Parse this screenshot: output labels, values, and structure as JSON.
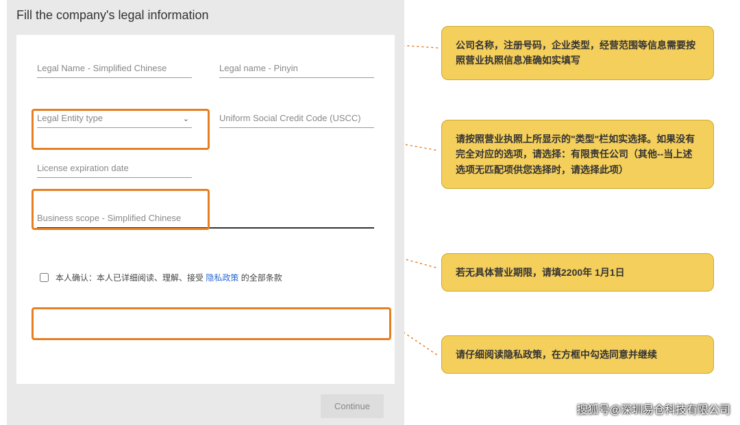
{
  "form": {
    "title": "Fill the company's legal information",
    "fields": {
      "legal_name_cn": {
        "placeholder": "Legal Name - Simplified Chinese"
      },
      "legal_name_py": {
        "placeholder": "Legal name - Pinyin"
      },
      "entity_type": {
        "placeholder": "Legal Entity type"
      },
      "uscc": {
        "placeholder": "Uniform Social Credit Code (USCC)"
      },
      "license_exp": {
        "placeholder": "License expiration date"
      },
      "business_scope": {
        "placeholder": "Business scope - Simplified Chinese"
      }
    },
    "consent": {
      "prefix": "本人确认：本人已详细阅读、理解、接受 ",
      "link": "隐私政策",
      "suffix": " 的全部条款"
    },
    "continue_label": "Continue"
  },
  "annotations": {
    "a1": "公司名称，注册号码，企业类型，经营范围等信息需要按照营业执照信息准确如实填写",
    "a2": "请按照营业执照上所显示的\"类型\"栏如实选择。如果没有完全对应的选项，请选择：有限责任公司（其他--当上述选项无匹配项供您选择时，请选择此项）",
    "a3": "若无具体营业期限，请填2200年 1月1日",
    "a4": "请仔细阅读隐私政策，在方框中勾选同意并继续"
  },
  "watermark": "搜狐号@深圳易仓科技有限公司"
}
